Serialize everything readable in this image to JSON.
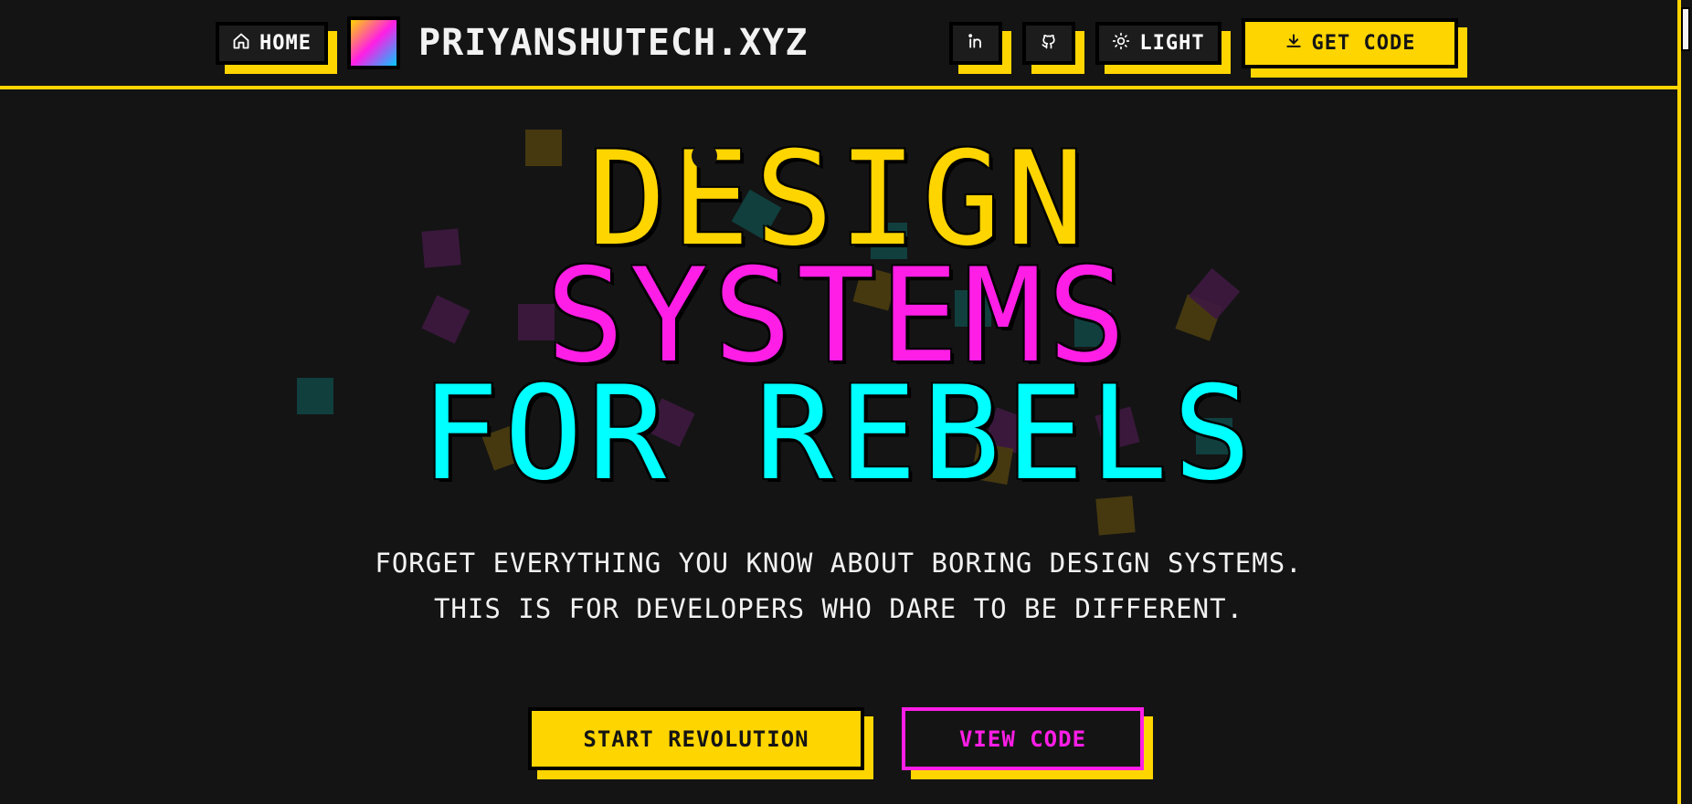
{
  "header": {
    "home_label": "HOME",
    "site_title": "PRIYANSHUTECH.XYZ",
    "theme_label": "LIGHT",
    "get_code_label": "GET CODE",
    "icons": {
      "home": "home-icon",
      "linkedin": "linkedin-icon",
      "github": "github-icon",
      "theme": "sun-icon",
      "download": "download-icon"
    }
  },
  "hero": {
    "line1": "DESIGN",
    "line2": "SYSTEMS",
    "line3": "FOR REBELS",
    "subtitle_line1": "FORGET EVERYTHING YOU KNOW ABOUT BORING DESIGN SYSTEMS.",
    "subtitle_line2": "THIS IS FOR DEVELOPERS WHO DARE TO BE DIFFERENT."
  },
  "cta": {
    "primary_label": "START REVOLUTION",
    "secondary_label": "VIEW CODE"
  },
  "colors": {
    "background": "#141414",
    "yellow": "#ffd500",
    "magenta": "#ff1ee6",
    "cyan": "#00ffff",
    "text": "#f2f2f2"
  }
}
